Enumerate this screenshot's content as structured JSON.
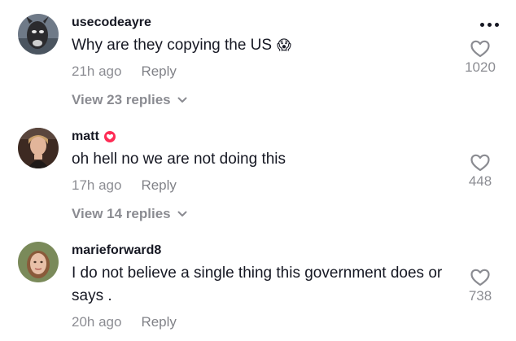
{
  "comments": [
    {
      "username": "usecodeayre",
      "text": "Why are they copying the US",
      "emoji": "😱",
      "time": "21h ago",
      "reply_label": "Reply",
      "likes": "1020",
      "view_replies": "View 23 replies"
    },
    {
      "username": "matt",
      "text": "oh hell no we are not doing this",
      "time": "17h ago",
      "reply_label": "Reply",
      "likes": "448",
      "view_replies": "View 14 replies"
    },
    {
      "username": "marieforward8",
      "text": "I do not believe a single thing this government does or says .",
      "time": "20h ago",
      "reply_label": "Reply",
      "likes": "738"
    }
  ],
  "icons": {
    "more": "more-options-icon",
    "like": "heart-outline-icon",
    "chevron": "chevron-down-icon",
    "badge": "heart-badge-icon"
  },
  "colors": {
    "text": "#161823",
    "muted": "#8a8b91",
    "badge": "#fe2c55"
  }
}
